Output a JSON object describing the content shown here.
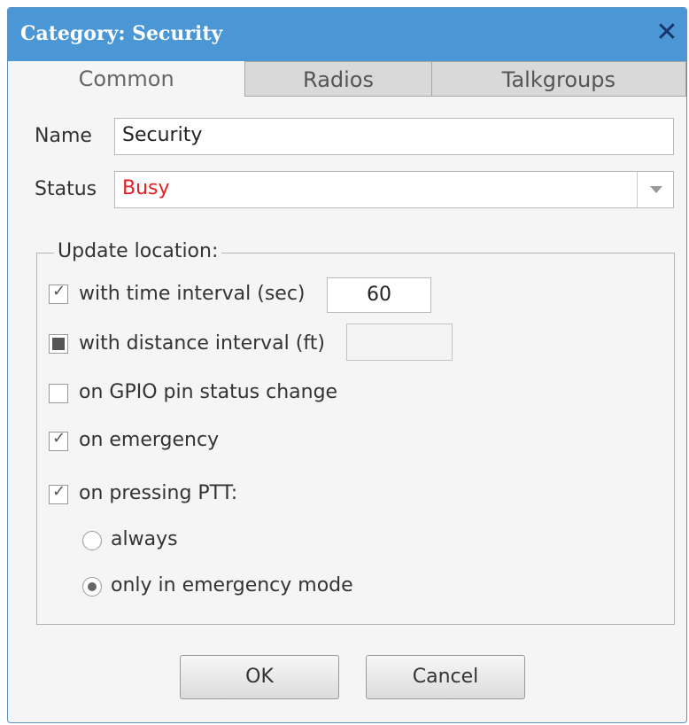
{
  "window": {
    "title": "Category: Security"
  },
  "tabs": [
    {
      "label": "Common",
      "active": true
    },
    {
      "label": "Radios",
      "active": false
    },
    {
      "label": "Talkgroups",
      "active": false
    }
  ],
  "form": {
    "name_label": "Name",
    "name_value": "Security",
    "status_label": "Status",
    "status_value": "Busy",
    "status_color": "#e81e25"
  },
  "update_location": {
    "label": "Update location:",
    "time_interval": {
      "label": "with time interval (sec)",
      "checked": true,
      "value": "60"
    },
    "distance_interval": {
      "label": "with distance interval (ft)",
      "checked": "indeterminate",
      "value": ""
    },
    "gpio": {
      "label": "on GPIO pin status change",
      "checked": false
    },
    "emergency": {
      "label": "on emergency",
      "checked": true
    },
    "ptt": {
      "label": "on pressing PTT:",
      "checked": true
    },
    "ptt_always": {
      "label": "always",
      "selected": false
    },
    "ptt_emergency_only": {
      "label": "only in emergency mode",
      "selected": true
    }
  },
  "buttons": {
    "ok": "OK",
    "cancel": "Cancel"
  }
}
